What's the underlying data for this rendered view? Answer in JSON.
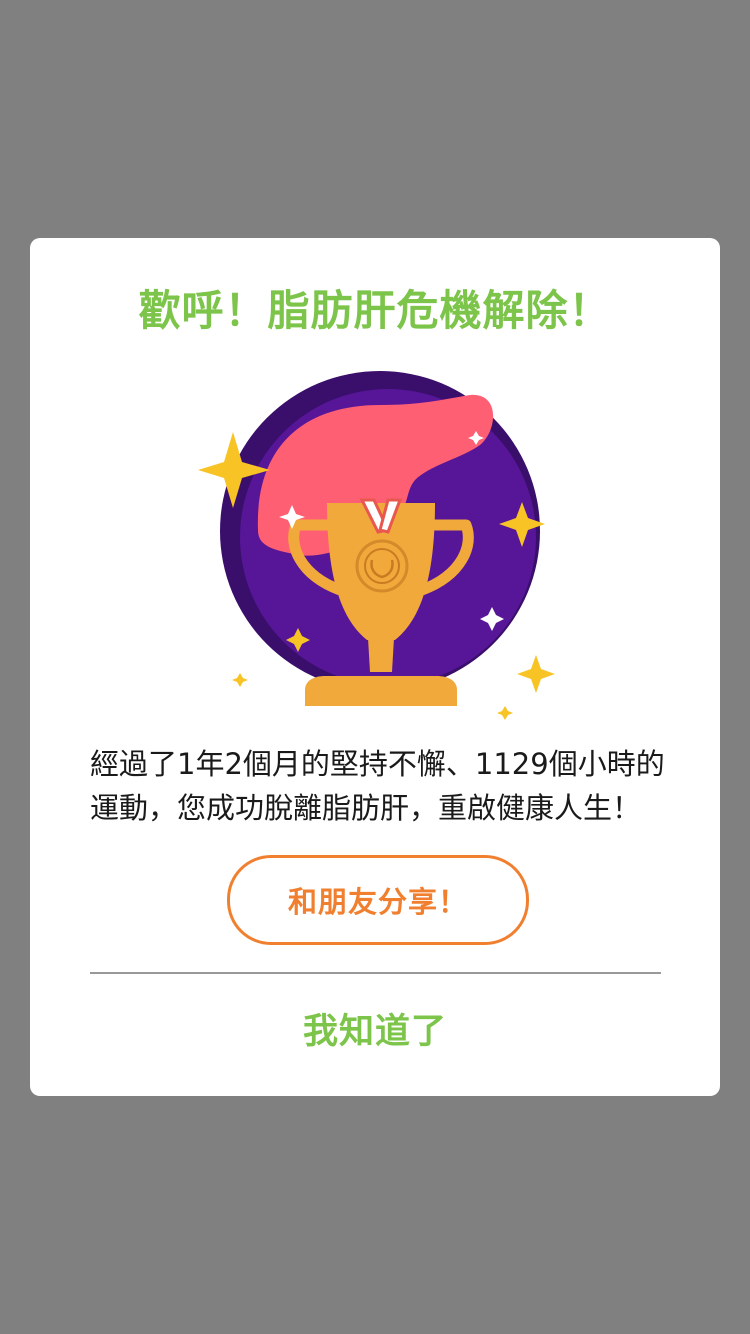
{
  "dialog": {
    "title": "歡呼！脂肪肝危機解除！",
    "message_line1": "經過了1年2個月的堅持不懈、1129個小時的",
    "message_line2": "運動，您成功脫離脂肪肝，重啟健康人生！",
    "share_label": "和朋友分享！",
    "ok_label": "我知道了"
  },
  "illustration": {
    "icons": [
      "trophy-icon",
      "medal-icon",
      "sparkle-icon"
    ]
  },
  "colors": {
    "overlay": "#808080",
    "title_green": "#7cc44a",
    "accent_orange": "#f08030",
    "circle_purple": "#4b1a7e",
    "blob_pink": "#ff5f73",
    "trophy_gold": "#f2a93b",
    "star_yellow": "#f7c325"
  }
}
